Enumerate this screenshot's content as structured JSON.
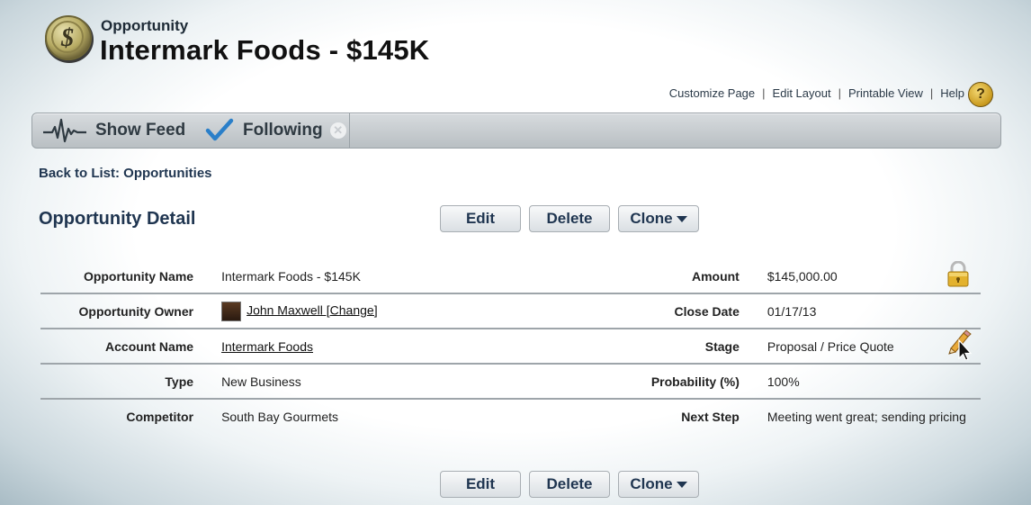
{
  "header": {
    "object_label": "Opportunity",
    "title": "Intermark Foods - $145K",
    "logo_icon": "dollar-coin-icon"
  },
  "top_links": {
    "customize": "Customize Page",
    "edit_layout": "Edit Layout",
    "printable": "Printable View",
    "help": "Help",
    "separator": "|",
    "help_icon_glyph": "?"
  },
  "feed_bar": {
    "show_feed": "Show Feed",
    "following": "Following",
    "unfollow_glyph": "✕"
  },
  "back_link": "Back to List: Opportunities",
  "section_title": "Opportunity Detail",
  "buttons": {
    "edit": "Edit",
    "delete": "Delete",
    "clone": "Clone"
  },
  "fields": {
    "opportunity_name_label": "Opportunity Name",
    "opportunity_name": "Intermark Foods - $145K",
    "amount_label": "Amount",
    "amount": "$145,000.00",
    "owner_label": "Opportunity Owner",
    "owner": "John Maxwell [Change]",
    "close_date_label": "Close Date",
    "close_date": "01/17/13",
    "account_label": "Account Name",
    "account": "Intermark Foods",
    "stage_label": "Stage",
    "stage": "Proposal / Price Quote",
    "type_label": "Type",
    "type": "New Business",
    "probability_label": "Probability (%)",
    "probability": "100%",
    "competitor_label": "Competitor",
    "competitor": "South Bay Gourmets",
    "next_step_label": "Next Step",
    "next_step": "Meeting went great; sending pricing"
  },
  "colors": {
    "heading": "#1f3550",
    "lock_gold": "#e3b22e"
  }
}
